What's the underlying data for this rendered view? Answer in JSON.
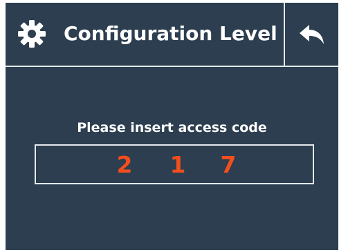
{
  "header": {
    "title": "Configuration Level",
    "icon": "gear-icon",
    "back_icon": "back-arrow-icon"
  },
  "main": {
    "prompt": "Please insert access code",
    "code_digits": [
      "2",
      "1",
      "7"
    ]
  },
  "colors": {
    "background": "#2c3e4f",
    "text": "#ffffff",
    "accent_digits": "#f24e1e",
    "border": "#e6eaee"
  }
}
